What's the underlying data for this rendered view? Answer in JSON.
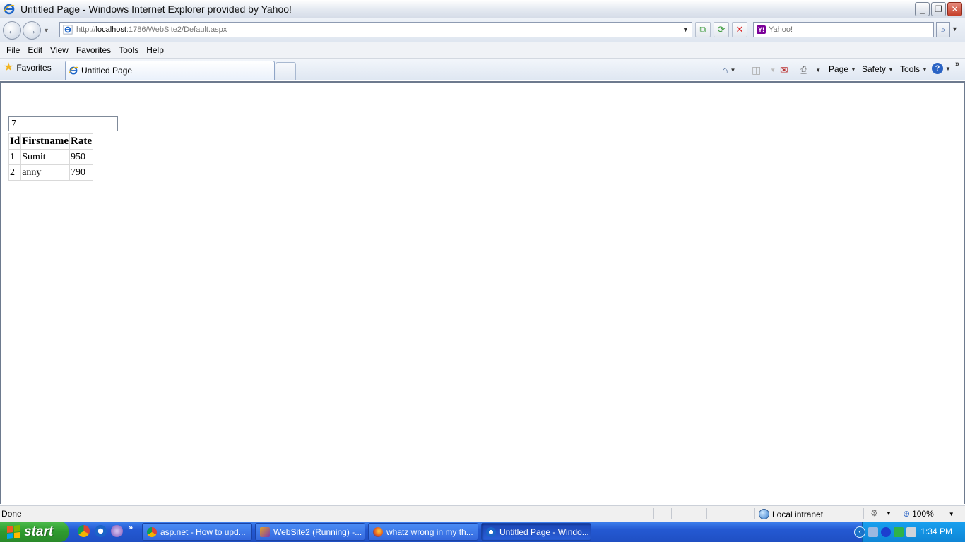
{
  "window": {
    "title": "Untitled Page - Windows Internet Explorer provided by Yahoo!",
    "minimize_glyph": "_",
    "restore_glyph": "❐",
    "close_glyph": "✕"
  },
  "navigation": {
    "back_glyph": "←",
    "forward_glyph": "→",
    "address_prefix": "http://",
    "address_host": "localhost",
    "address_rest": ":1786/WebSite2/Default.aspx",
    "search_placeholder": "Yahoo!",
    "search_logo": "Y!"
  },
  "menu": [
    "File",
    "Edit",
    "View",
    "Favorites",
    "Tools",
    "Help"
  ],
  "tabs": {
    "favorites_label": "Favorites",
    "active_tab_label": "Untitled Page"
  },
  "command_bar": {
    "page_label": "Page",
    "safety_label": "Safety",
    "tools_label": "Tools",
    "help_glyph": "?"
  },
  "page": {
    "textbox_value": "7",
    "table": {
      "headers": [
        "Id",
        "Firstname",
        "Rate"
      ],
      "rows": [
        [
          "1",
          "Sumit",
          "950"
        ],
        [
          "2",
          "anny",
          "790"
        ]
      ]
    }
  },
  "status": {
    "text": "Done",
    "zone": "Local intranet",
    "zoom": "100%"
  },
  "taskbar": {
    "start_label": "start",
    "tasks": [
      "asp.net - How to upd...",
      "WebSite2 (Running) -...",
      "whatz wrong in my th...",
      "Untitled Page - Windo..."
    ],
    "clock": "1:34 PM"
  },
  "colors": {
    "taskbar_blue": "#2459d2",
    "start_green": "#2e9a2e",
    "tray_blue": "#0f86d6",
    "ie_blue": "#1b64c8",
    "close_red": "#c6402b"
  }
}
